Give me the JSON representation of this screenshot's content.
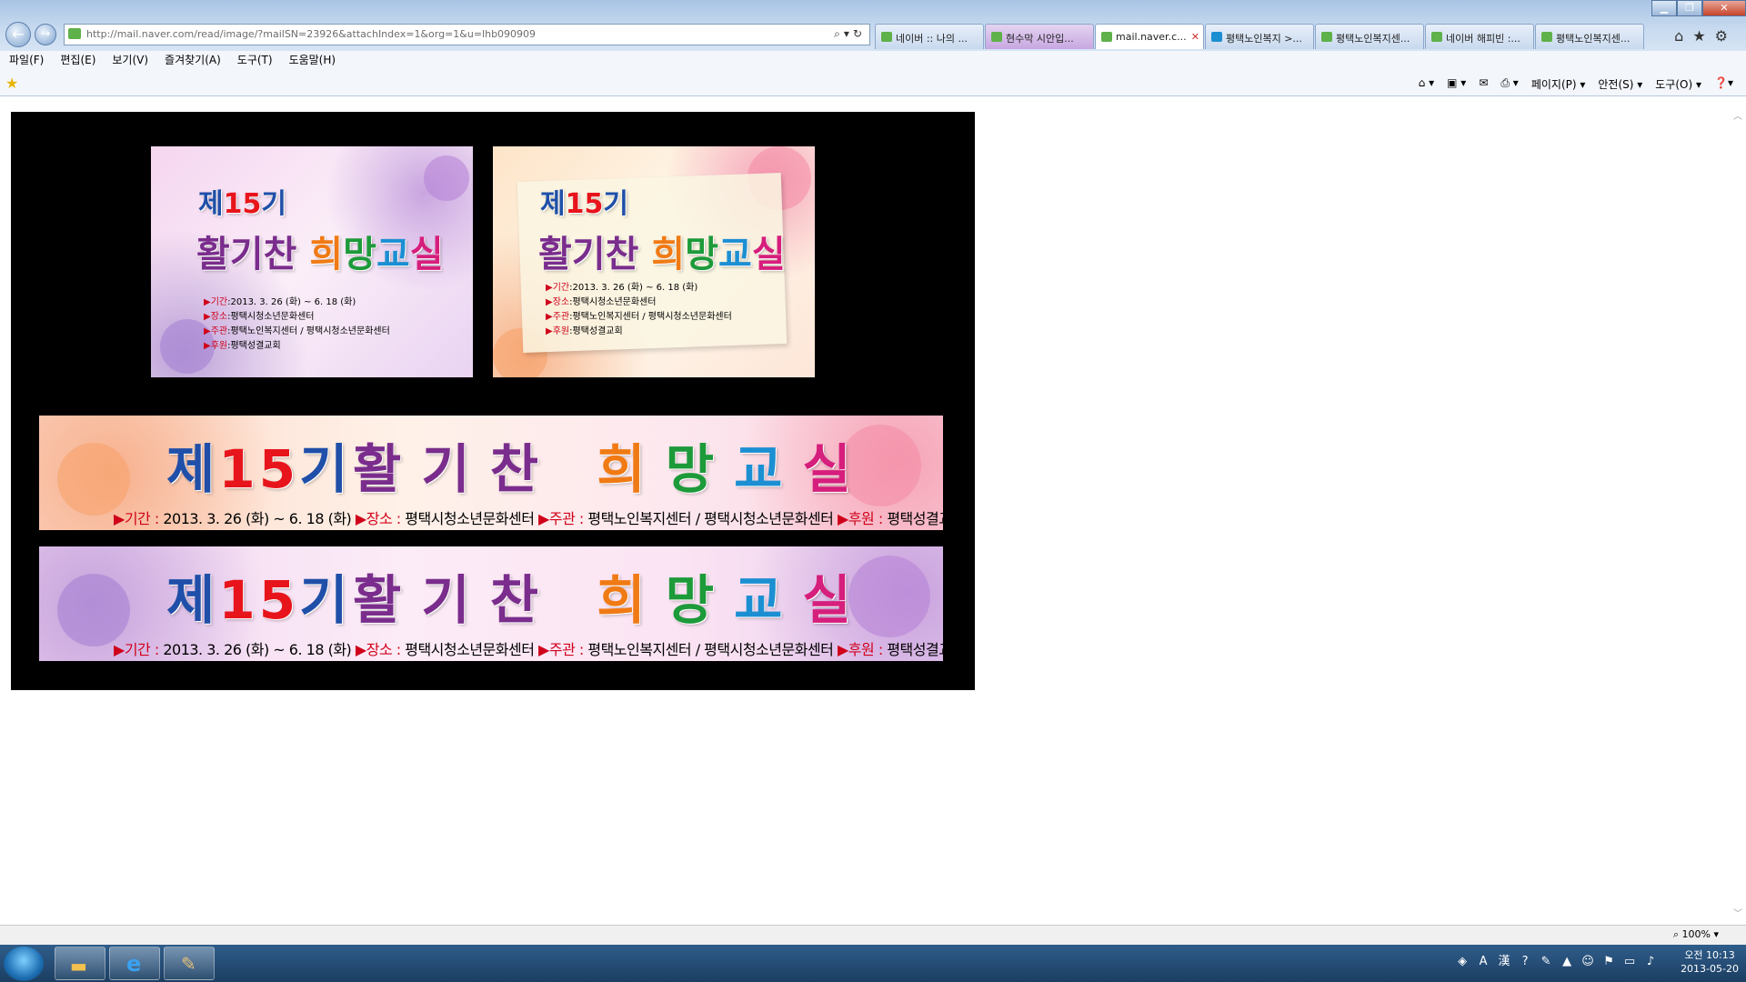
{
  "window": {
    "address_url": "http://mail.naver.com/read/image/?mailSN=23926&attachIndex=1&org=1&u=lhb090909",
    "tabs": [
      {
        "label": "네이버 :: 나의 ...",
        "color": "#5fb14a"
      },
      {
        "label": "현수막 시안입...",
        "color": "#5fb14a"
      },
      {
        "label": "mail.naver.c...",
        "color": "#5fb14a",
        "active": true
      },
      {
        "label": "평택노인복지 >...",
        "color": "#1c8fd2"
      },
      {
        "label": "평택노인복지센...",
        "color": "#5fb14a"
      },
      {
        "label": "네이버 해피빈 :...",
        "color": "#5fb14a"
      },
      {
        "label": "평택노인복지센...",
        "color": "#5fb14a"
      }
    ]
  },
  "menubar": {
    "items": [
      "파일(F)",
      "편집(E)",
      "보기(V)",
      "즐겨찾기(A)",
      "도구(T)",
      "도움말(H)"
    ]
  },
  "commandbar": {
    "page_label": "페이지(P) ▾",
    "safety_label": "안전(S) ▾",
    "tools_label": "도구(O) ▾"
  },
  "posters": {
    "prefix": "제",
    "number": "15",
    "suffix": "기",
    "w1": "활",
    "w2": "기",
    "w3": "찬",
    "w4": "희",
    "w5": "망",
    "w6": "교",
    "w7": "실",
    "period_label": "기간",
    "period_value": "2013. 3. 26 (화) ~ 6. 18 (화)",
    "place_label": "장소",
    "place_value": "평택시청소년문화센터",
    "host_label": "주관",
    "host_value": "평택노인복지센터 / 평택시청소년문화센터",
    "sponsor_label": "후원",
    "sponsor_value": "평택성결교회",
    "wide_period_value": "2013. 3. 26 (화) ~ 6. 18 (화)"
  },
  "statusbar": {
    "zoom": "100%"
  },
  "taskbar": {
    "time": "오전 10:13",
    "date": "2013-05-20"
  }
}
